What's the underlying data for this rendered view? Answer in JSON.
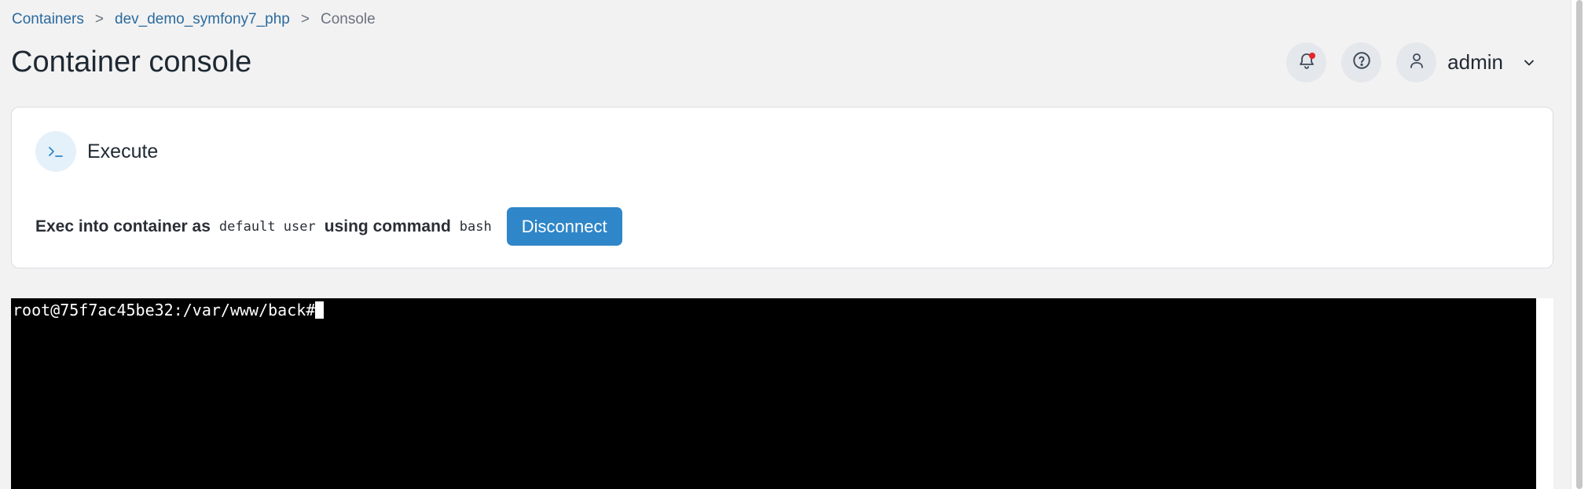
{
  "breadcrumb": {
    "items": [
      "Containers",
      "dev_demo_symfony7_php"
    ],
    "current": "Console",
    "separator": ">"
  },
  "page": {
    "title": "Container console"
  },
  "header": {
    "user_name": "admin",
    "icons": [
      "bell-icon",
      "help-icon",
      "user-icon",
      "chevron-down-icon"
    ],
    "notification_dot_color": "#e5252a"
  },
  "card": {
    "title": "Execute",
    "icon": "terminal-prompt-icon",
    "exec_prefix": "Exec into container as",
    "exec_user": "default user",
    "exec_middle": "using command",
    "exec_command": "bash",
    "disconnect_label": "Disconnect"
  },
  "terminal": {
    "prompt": "root@75f7ac45be32:/var/www/back#"
  },
  "colors": {
    "accent": "#2f86c8",
    "link": "#2b6a9e",
    "terminal_bg": "#000000"
  }
}
